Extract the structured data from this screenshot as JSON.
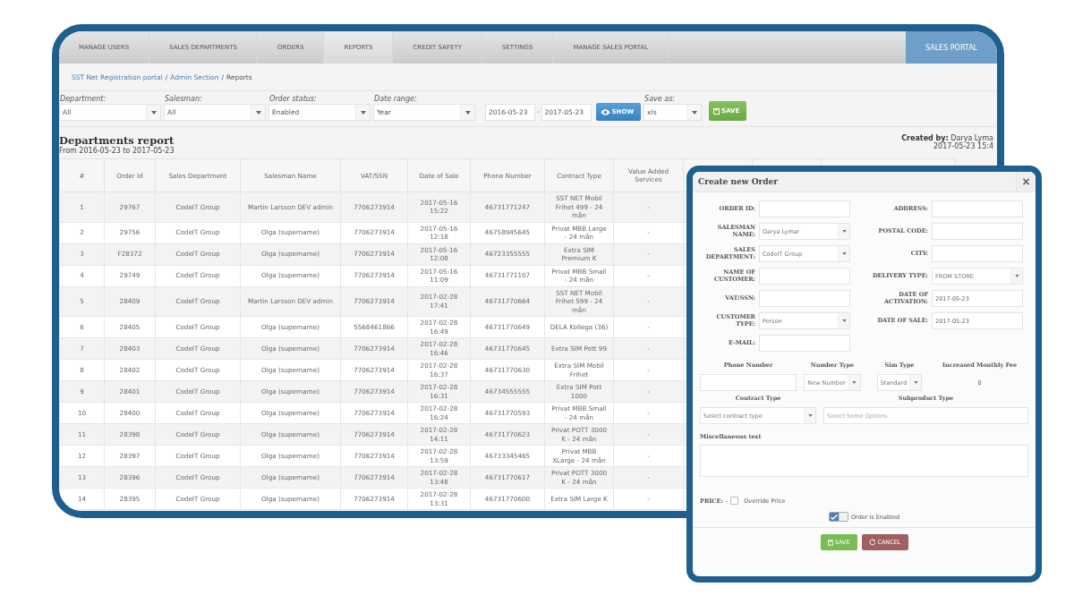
{
  "nav": {
    "tabs": [
      {
        "label": "MANAGE USERS",
        "selected": false
      },
      {
        "label": "SALES DEPARTMENTS",
        "selected": false
      },
      {
        "label": "ORDERS",
        "selected": false
      },
      {
        "label": "REPORTS",
        "selected": true
      },
      {
        "label": "CREDIT SAFETY",
        "selected": false
      },
      {
        "label": "SETTINGS",
        "selected": false
      },
      {
        "label": "MANAGE SALES PORTAL",
        "selected": false
      }
    ],
    "portal_button": "SALES PORTAL"
  },
  "breadcrumb": {
    "separator": "/",
    "items": [
      {
        "label": "SST Net Registration portal",
        "kind": "link"
      },
      {
        "label": "Admin Section",
        "kind": "link"
      },
      {
        "label": "Reports",
        "kind": "current"
      }
    ]
  },
  "filters": [
    {
      "label": "Department:",
      "value": "All"
    },
    {
      "label": "Salesman:",
      "value": "All"
    },
    {
      "label": "Order status:",
      "value": "Enabled"
    },
    {
      "label": "Date range:",
      "value": "Year"
    }
  ],
  "date_from": "2016-05-23",
  "date_separator": "-",
  "date_to": "2017-05-23",
  "show_button": "SHOW",
  "save_as": {
    "label": "Save as:",
    "value": "xls"
  },
  "save_button": "SAVE",
  "report": {
    "title": "Departments report",
    "subtitle": "From 2016-05-23 to 2017-05-23",
    "created_by_label": "Created by:",
    "created_by": "Darya Lyma",
    "created_at": "2017-05-23 15:4"
  },
  "table": {
    "columns": [
      "#",
      "Order Id",
      "Sales Department",
      "Salesman Name",
      "VAT/SSN",
      "Date of Sale",
      "Phone Number",
      "Contract Type",
      "Value Added Services"
    ],
    "rows": [
      [
        "1",
        "29767",
        "CodeIT Group",
        "Martin Larsson DEV admin",
        "7706273914",
        "2017-05-16 15:22",
        "46731771247",
        "SST NET Mobil Frihet 499 - 24 mån",
        "-"
      ],
      [
        "2",
        "29756",
        "CodeIT Group",
        "Olga (supername)",
        "7706273914",
        "2017-05-16 12:18",
        "46758945645",
        "Privat MBB Large - 24 mån",
        "-"
      ],
      [
        "3",
        "F28372",
        "CodeIT Group",
        "Olga (supername)",
        "7706273914",
        "2017-05-16 12:08",
        "46723355555",
        "Extra SIM Premium K",
        "-"
      ],
      [
        "4",
        "29749",
        "CodeIT Group",
        "Olga (supername)",
        "7706273914",
        "2017-05-16 11:09",
        "46731771107",
        "Privat MBB Small - 24 mån",
        "-"
      ],
      [
        "5",
        "28409",
        "CodeIT Group",
        "Martin Larsson DEV admin",
        "7706273914",
        "2017-02-28 17:41",
        "46731770664",
        "SST NET Mobil Frihet 599 - 24 mån",
        "-"
      ],
      [
        "6",
        "28405",
        "CodeIT Group",
        "Olga (supername)",
        "5568461866",
        "2017-02-28 16:49",
        "46731770649",
        "DELA Kollega (36)",
        "-"
      ],
      [
        "7",
        "28403",
        "CodeIT Group",
        "Olga (supername)",
        "7706273914",
        "2017-02-28 16:46",
        "46731770645",
        "Extra SIM Pott 99",
        "-"
      ],
      [
        "8",
        "28402",
        "CodeIT Group",
        "Olga (supername)",
        "7706273914",
        "2017-02-28 16:37",
        "46731770630",
        "Extra SIM Mobil Frihet",
        "-"
      ],
      [
        "9",
        "28401",
        "CodeIT Group",
        "Olga (supername)",
        "7706273914",
        "2017-02-28 16:31",
        "46734555555",
        "Extra SIM Pott 1000",
        "-"
      ],
      [
        "10",
        "28400",
        "CodeIT Group",
        "Olga (supername)",
        "7706273914",
        "2017-02-28 16:24",
        "46731770593",
        "Privat MBB Small - 24 mån",
        "-"
      ],
      [
        "11",
        "28398",
        "CodeIT Group",
        "Olga (supername)",
        "7706273914",
        "2017-02-28 14:11",
        "46731770623",
        "Privat POTT 3000 K - 24 mån",
        "-"
      ],
      [
        "12",
        "28397",
        "CodeIT Group",
        "Olga (supername)",
        "7706273914",
        "2017-02-28 13:59",
        "46733345465",
        "Privat MBB XLarge - 24 mån",
        "-"
      ],
      [
        "13",
        "28396",
        "CodeIT Group",
        "Olga (supername)",
        "7706273914",
        "2017-02-28 13:48",
        "46731770617",
        "Privat POTT 3000 K - 24 mån",
        "-"
      ],
      [
        "14",
        "28395",
        "CodeIT Group",
        "Olga (supername)",
        "7706273914",
        "2017-02-28 13:31",
        "46731770600",
        "Extra SIM Large K",
        "-"
      ]
    ]
  },
  "dialog": {
    "title": "Create new Order",
    "close": "×",
    "left_fields": [
      {
        "label": "ORDER ID:",
        "kind": "input"
      },
      {
        "label": "SALESMAN NAME:",
        "kind": "select",
        "value": "Darya Lymar"
      },
      {
        "label": "SALES DEPARTMENT:",
        "kind": "select",
        "value": "CodeIT Group"
      },
      {
        "label": "NAME OF CUSTOMER:",
        "kind": "input"
      },
      {
        "label": "VAT/SSN:",
        "kind": "input"
      },
      {
        "label": "CUSTOMER TYPE:",
        "kind": "select",
        "value": "Person"
      },
      {
        "label": "E-MAIL:",
        "kind": "input"
      }
    ],
    "right_fields": [
      {
        "label": "ADDRESS:",
        "kind": "input"
      },
      {
        "label": "POSTAL CODE:",
        "kind": "input"
      },
      {
        "label": "CITY:",
        "kind": "input"
      },
      {
        "label": "DELIVERY TYPE:",
        "kind": "select",
        "value": "FROM STORE"
      },
      {
        "label": "DATE OF ACTIVATION:",
        "kind": "input",
        "value": "2017-05-23"
      },
      {
        "label": "DATE OF SALE:",
        "kind": "input",
        "value": "2017-05-23"
      }
    ],
    "phone_number_label": "Phone Number",
    "number_type": {
      "label": "Number Type",
      "value": "New Number"
    },
    "sim_type": {
      "label": "Sim Type",
      "value": "Standard"
    },
    "fee": {
      "label": "Increased Monthly Fee",
      "value": "0"
    },
    "contract_type": {
      "label": "Contract Type",
      "value": "Select contract type"
    },
    "subproduct_type": {
      "label": "Subproduct Type",
      "placeholder": "Select Some Options"
    },
    "misc_label": "Miscellaneous text",
    "price_label": "PRICE:",
    "price_value": "-",
    "override_price": {
      "label": "Override Price",
      "checked": false
    },
    "order_enabled": {
      "label": "Order is Enabled",
      "checked": true
    },
    "save_button": "SAVE",
    "cancel_button": "CANCEL"
  }
}
